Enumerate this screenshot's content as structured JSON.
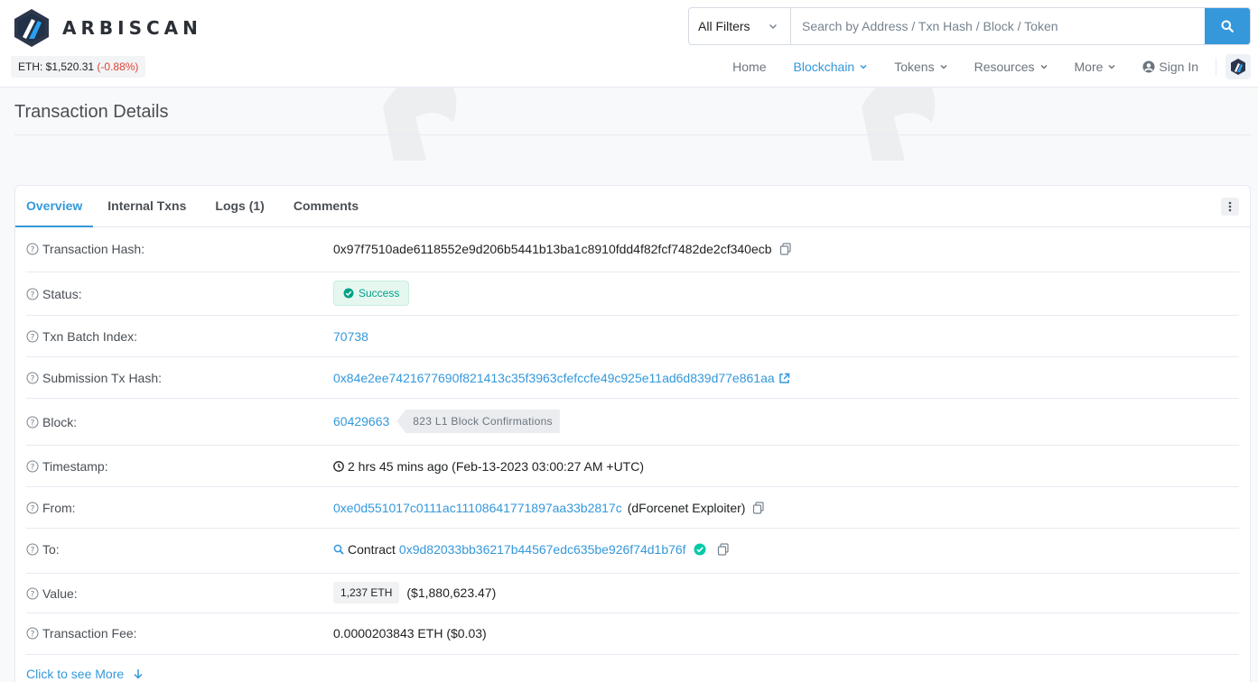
{
  "brand": {
    "name": "ARBISCAN"
  },
  "header": {
    "eth_price_label": "ETH: $1,520.31",
    "eth_price_change": "(-0.88%)",
    "search": {
      "filter_label": "All Filters",
      "placeholder": "Search by Address / Txn Hash / Block / Token"
    },
    "nav": {
      "home": "Home",
      "blockchain": "Blockchain",
      "tokens": "Tokens",
      "resources": "Resources",
      "more": "More",
      "sign_in": "Sign In"
    }
  },
  "page": {
    "title": "Transaction Details"
  },
  "tabs": [
    "Overview",
    "Internal Txns",
    "Logs (1)",
    "Comments"
  ],
  "details": {
    "tx_hash": {
      "label": "Transaction Hash:",
      "value": "0x97f7510ade6118552e9d206b5441b13ba1c8910fdd4f82fcf7482de2cf340ecb"
    },
    "status": {
      "label": "Status:",
      "value": "Success"
    },
    "batch_index": {
      "label": "Txn Batch Index:",
      "value": "70738"
    },
    "submission_hash": {
      "label": "Submission Tx Hash:",
      "value": "0x84e2ee7421677690f821413c35f3963cfefccfe49c925e11ad6d839d77e861aa"
    },
    "block": {
      "label": "Block:",
      "value": "60429663",
      "confirmations": "823 L1 Block Confirmations"
    },
    "timestamp": {
      "label": "Timestamp:",
      "value": "2 hrs 45 mins ago (Feb-13-2023 03:00:27 AM +UTC)"
    },
    "from": {
      "label": "From:",
      "address": "0xe0d551017c0111ac11108641771897aa33b2817c",
      "name_tag": "(dForcenet Exploiter)"
    },
    "to": {
      "label": "To:",
      "prefix": "Contract",
      "address": "0x9d82033bb36217b44567edc635be926f74d1b76f"
    },
    "value": {
      "label": "Value:",
      "amount": "1,237 ETH",
      "usd": "($1,880,623.47)"
    },
    "fee": {
      "label": "Transaction Fee:",
      "value": "0.0000203843 ETH ($0.03)"
    }
  },
  "see_more": "Click to see More",
  "colors": {
    "accent": "#3498db",
    "success": "#00a186",
    "negative": "#de4437"
  }
}
